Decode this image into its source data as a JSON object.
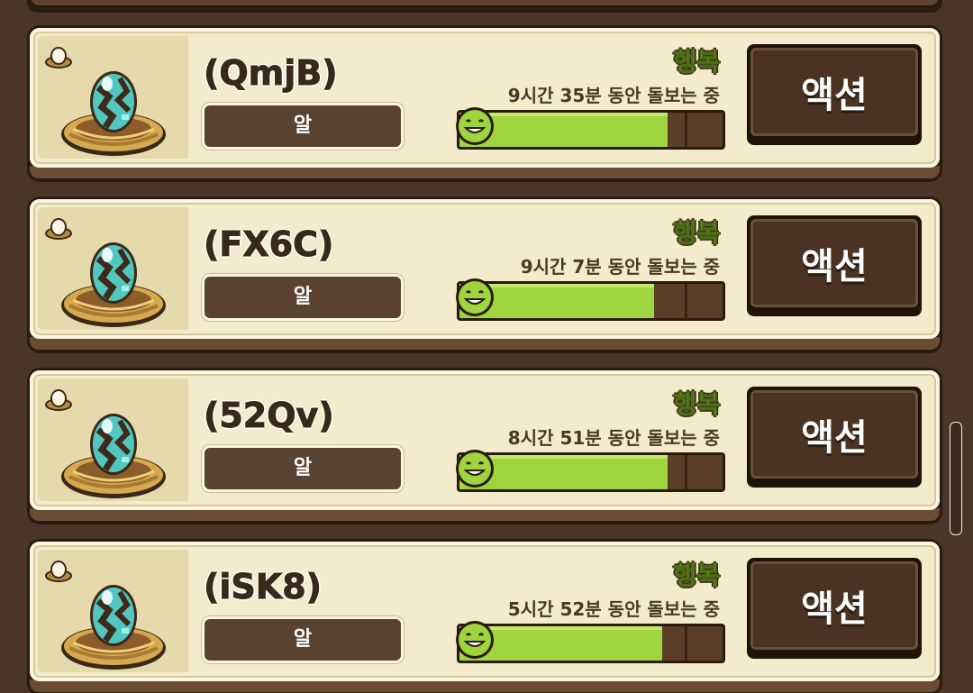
{
  "pets": [
    {
      "name": "(QmjB)",
      "stage": "알",
      "mood": "행복",
      "care_time": "9시간 35분 동안 돌보는 중",
      "happiness_fraction": 0.79,
      "action_label": "액션"
    },
    {
      "name": "(FX6C)",
      "stage": "알",
      "mood": "행복",
      "care_time": "9시간 7분 동안 돌보는 중",
      "happiness_fraction": 0.74,
      "action_label": "액션"
    },
    {
      "name": "(52Qv)",
      "stage": "알",
      "mood": "행복",
      "care_time": "8시간 51분 동안 돌보는 중",
      "happiness_fraction": 0.79,
      "action_label": "액션"
    },
    {
      "name": "(iSK8)",
      "stage": "알",
      "mood": "행복",
      "care_time": "5시간 52분 동안 돌보는 중",
      "happiness_fraction": 0.77,
      "action_label": "액션"
    }
  ],
  "colors": {
    "mood_green": "#9ccf3e",
    "bar_fill": "#a0d43f",
    "card_bg": "#f3ebcb",
    "panel_brown": "#4b3526"
  },
  "icons": {
    "card_badge": "egg-badge-icon",
    "portrait": "egg-in-nest-icon",
    "bar_face": "smiley-face-icon"
  }
}
